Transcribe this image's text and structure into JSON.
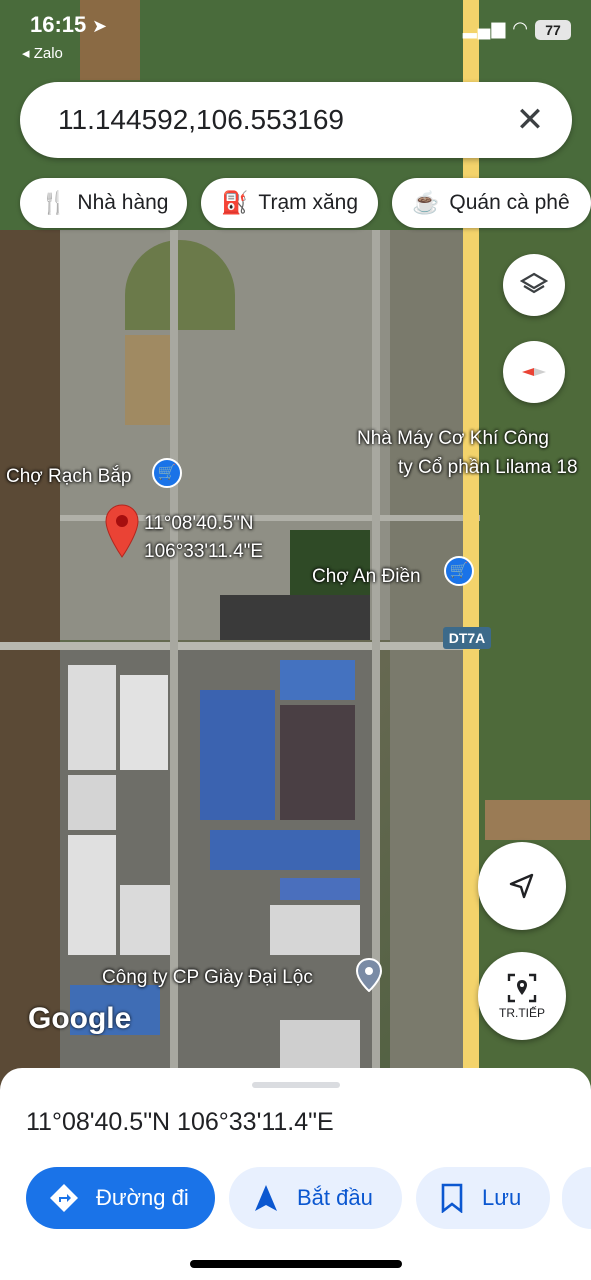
{
  "status_bar": {
    "time": "16:15",
    "back_app": "◂ Zalo",
    "battery": "77"
  },
  "search": {
    "query": "11.144592,106.553169"
  },
  "chips": [
    {
      "label": "Nhà hàng",
      "icon": "restaurant-icon"
    },
    {
      "label": "Trạm xăng",
      "icon": "gas-station-icon"
    },
    {
      "label": "Quán cà phê",
      "icon": "coffee-icon"
    }
  ],
  "map": {
    "pin_lat": "11°08'40.5\"N",
    "pin_lng": "106°33'11.4\"E",
    "labels": {
      "cho_rach_bap": "Chợ Rạch Bắp",
      "lilama_line1": "Nhà Máy Cơ Khí Công",
      "lilama_line2": "ty Cổ phần Lilama 18",
      "cho_an_dien": "Chợ An Điền",
      "road": "DT7A",
      "giay_dai_loc": "Công ty CP Giày Đại Lộc"
    },
    "logo": "Google",
    "streetview_label": "TR.TIẾP"
  },
  "sheet": {
    "coords": "11°08'40.5\"N 106°33'11.4\"E",
    "directions_label": "Đường đi",
    "start_label": "Bắt đầu",
    "save_label": "Lưu"
  },
  "colors": {
    "accent": "#1a73e8",
    "pin": "#ea4335",
    "highway": "#f3d36b"
  }
}
